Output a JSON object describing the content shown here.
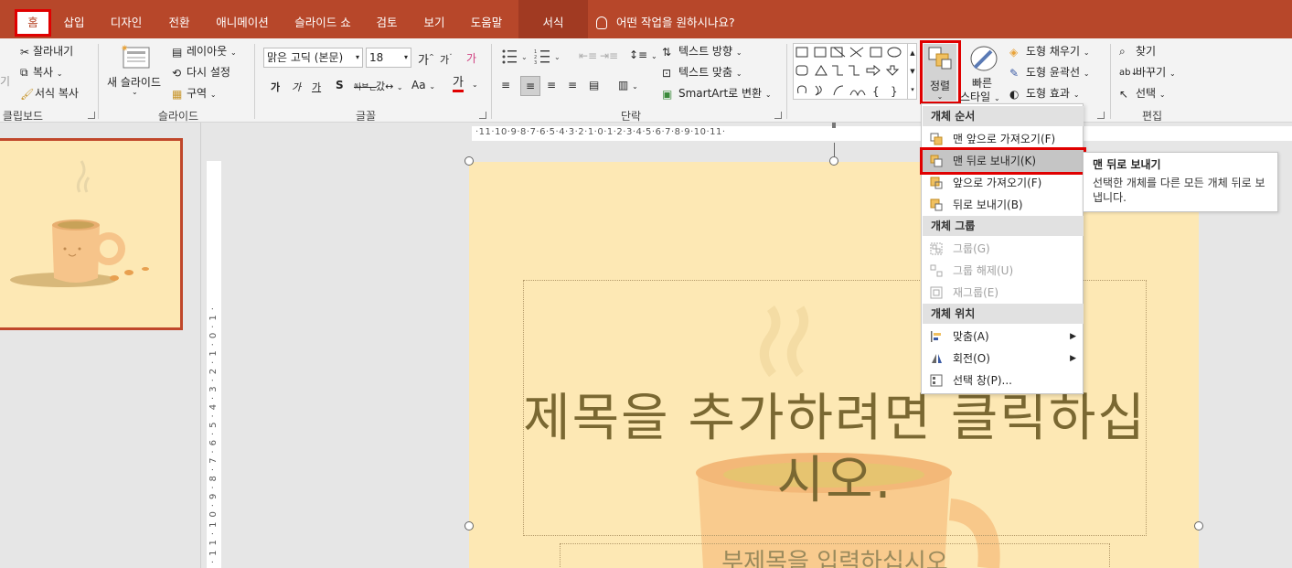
{
  "tabs": [
    {
      "label": "홈",
      "active": true
    },
    {
      "label": "삽입"
    },
    {
      "label": "디자인"
    },
    {
      "label": "전환"
    },
    {
      "label": "애니메이션"
    },
    {
      "label": "슬라이드 쇼"
    },
    {
      "label": "검토"
    },
    {
      "label": "보기"
    },
    {
      "label": "도움말"
    },
    {
      "label": "서식"
    }
  ],
  "tell_me": "어떤 작업을 원하시나요?",
  "clipboard": {
    "cut": "잘라내기",
    "copy": "복사",
    "format_painter": "서식 복사",
    "paste_partial": "기",
    "group_label": "클립보드"
  },
  "slides_group": {
    "new_slide": "새 슬라이드",
    "layout": "레이아웃",
    "reset": "다시 설정",
    "section": "구역",
    "group_label": "슬라이드"
  },
  "font_group": {
    "font_name": "맑은 고딕 (본문)",
    "font_size": "18",
    "grow": "가",
    "shrink": "가",
    "clear": "가",
    "bold": "가",
    "italic": "가",
    "underline": "가",
    "shadow": "S",
    "strike": "ᅅᅡᄇᆫ",
    "spacing": "갔↔",
    "case": "Aa",
    "color": "가",
    "group_label": "글꼴"
  },
  "paragraph_group": {
    "text_direction": "텍스트 방향",
    "align_text": "텍스트 맞춤",
    "smartart": "SmartArt로 변환",
    "group_label": "단락"
  },
  "drawing_group": {
    "arrange": "정렬",
    "quick_styles_line1": "빠른",
    "quick_styles_line2": "스타일",
    "shape_fill": "도형 채우기",
    "shape_outline": "도형 윤곽선",
    "shape_effects": "도형 효과"
  },
  "editing_group": {
    "find": "찾기",
    "replace": "바꾸기",
    "select": "선택",
    "group_label": "편집"
  },
  "ruler": {
    "horizontal": "·11·10·9·8·7·6·5·4·3·2·1·0·1·2·3·4·5·6·7·8·9·10·11·",
    "vertical": "·11·10·9·8·7·6·5·4·3·2·1·0·1·"
  },
  "slide": {
    "title": "제목을 추가하려면 클릭하십시오.",
    "subtitle": "부제목을 입력하십시오"
  },
  "arrange_menu": {
    "order_header": "개체 순서",
    "bring_to_front": "맨 앞으로 가져오기(F)",
    "send_to_back": "맨 뒤로 보내기(K)",
    "bring_forward": "앞으로 가져오기(F)",
    "send_backward": "뒤로 보내기(B)",
    "group_header": "개체 그룹",
    "group": "그룹(G)",
    "ungroup": "그룹 해제(U)",
    "regroup": "재그룹(E)",
    "position_header": "개체 위치",
    "align": "맞춤(A)",
    "rotate": "회전(O)",
    "selection_pane": "선택 창(P)..."
  },
  "tooltip": {
    "title": "맨 뒤로 보내기",
    "body": "선택한 개체를 다른 모든 개체 뒤로 보냅니다."
  },
  "colors": {
    "accent": "#b7472a",
    "highlight_box": "#e00000",
    "slide_bg": "#fde8b4"
  }
}
